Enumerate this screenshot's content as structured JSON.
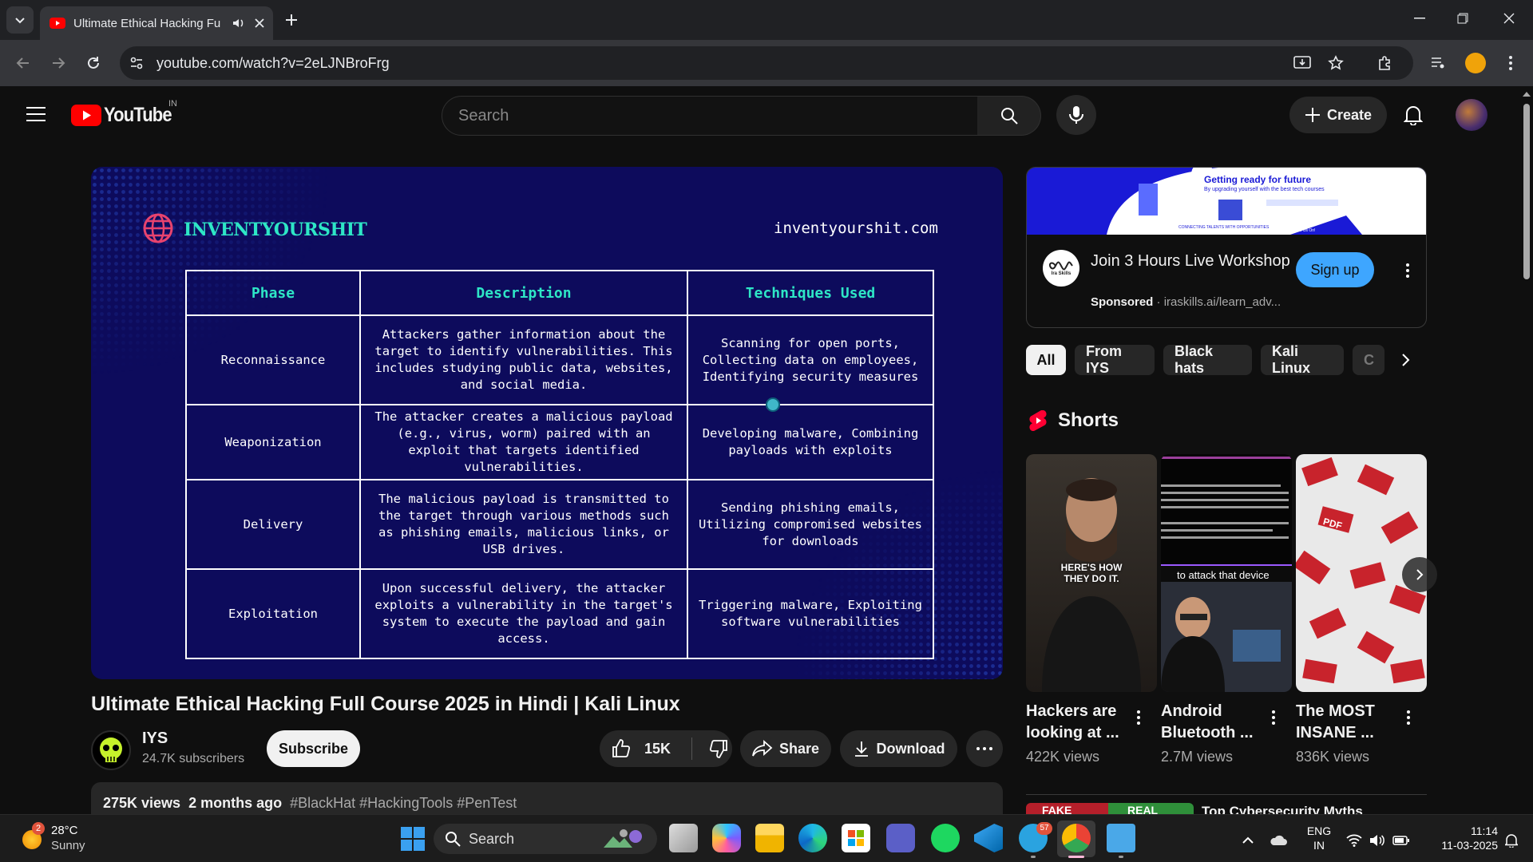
{
  "browser": {
    "tab_title": "Ultimate Ethical Hacking Fu",
    "url": "youtube.com/watch?v=2eLJNBroFrg"
  },
  "youtube": {
    "logo_text": "YouTube",
    "region": "IN",
    "search_placeholder": "Search",
    "create_label": "Create"
  },
  "video": {
    "brand": "INVENTYOURSHIT",
    "site": "inventyourshit.com",
    "table": {
      "headers": [
        "Phase",
        "Description",
        "Techniques Used"
      ],
      "rows": [
        {
          "phase": "Reconnaissance",
          "description": "Attackers gather information about the target to identify vulnerabilities. This includes studying public data, websites, and social media.",
          "techniques": "Scanning for open ports, Collecting data on employees, Identifying security measures"
        },
        {
          "phase": "Weaponization",
          "description": "The attacker creates a malicious payload (e.g., virus, worm) paired with an exploit that targets identified vulnerabilities.",
          "techniques": "Developing malware, Combining payloads with exploits"
        },
        {
          "phase": "Delivery",
          "description": "The malicious payload is transmitted to the target through various methods such as phishing emails, malicious links, or USB drives.",
          "techniques": "Sending phishing emails, Utilizing compromised websites for downloads"
        },
        {
          "phase": "Exploitation",
          "description": "Upon successful delivery, the attacker exploits a vulnerability in the target's system to execute the payload and gain access.",
          "techniques": "Triggering malware, Exploiting software vulnerabilities"
        }
      ]
    },
    "title": "Ultimate Ethical Hacking Full Course 2025 in Hindi | Kali Linux",
    "channel_name": "IYS",
    "subscribers": "24.7K subscribers",
    "subscribe_label": "Subscribe",
    "likes": "15K",
    "share_label": "Share",
    "download_label": "Download",
    "views": "275K views",
    "age": "2 months ago",
    "hashtags": "#BlackHat #HackingTools #PenTest"
  },
  "ad": {
    "banner_headline": "Getting ready for future",
    "banner_sub": "By upgrading yourself with the best tech courses",
    "banner_foot": "CONNECTING TALENTS WITH OPPORTUNITIES",
    "banner_follow": "Follow Us On!",
    "logo_text": "Ira Skills",
    "title": "Join 3 Hours Live Workshop",
    "sponsored": "Sponsored",
    "url": "iraskills.ai/learn_adv...",
    "signup_label": "Sign up"
  },
  "chips": [
    "All",
    "From IYS",
    "Black hats",
    "Kali Linux",
    "C"
  ],
  "shorts": {
    "heading": "Shorts",
    "items": [
      {
        "title": "Hackers are looking at ...",
        "views": "422K views",
        "overlay": "HERE'S HOW THEY DO IT."
      },
      {
        "title": "Android Bluetooth ...",
        "views": "2.7M views",
        "overlay": "to attack that device"
      },
      {
        "title": "The MOST INSANE ...",
        "views": "836K views",
        "overlay": "PDF"
      }
    ]
  },
  "next_item": {
    "title": "Top Cybersecurity Myths",
    "thumb_left": "FAKE",
    "thumb_right": "REAL"
  },
  "taskbar": {
    "weather_temp": "28°C",
    "weather_cond": "Sunny",
    "weather_badge": "2",
    "search_label": "Search",
    "telegram_badge": "57",
    "lang_line1": "ENG",
    "lang_line2": "IN",
    "time": "11:14",
    "date": "11-03-2025"
  },
  "colors": {
    "yt_red": "#ff0000",
    "video_bg": "#0d0b5c",
    "table_header_teal": "#2ee6c6",
    "signup_blue": "#3ea6ff",
    "profile_orange": "#f0a30a"
  }
}
